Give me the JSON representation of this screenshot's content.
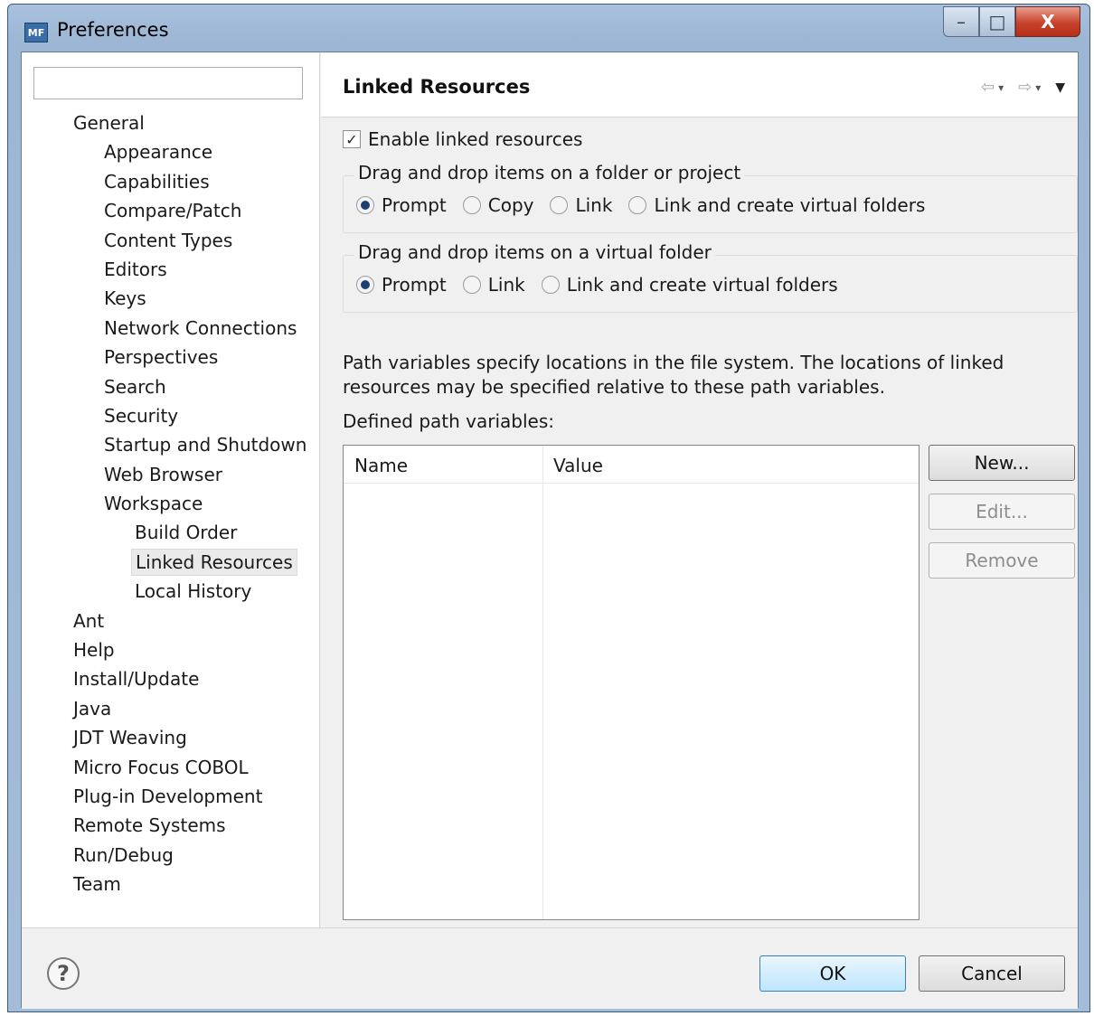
{
  "window": {
    "title": "Preferences",
    "app_icon_text": "MF",
    "minimize_glyph": "–",
    "maximize_glyph": "□",
    "close_glyph": "X"
  },
  "tree": {
    "filter_value": "",
    "items": [
      {
        "label": "General",
        "level": 0
      },
      {
        "label": "Appearance",
        "level": 1
      },
      {
        "label": "Capabilities",
        "level": 1
      },
      {
        "label": "Compare/Patch",
        "level": 1
      },
      {
        "label": "Content Types",
        "level": 1
      },
      {
        "label": "Editors",
        "level": 1
      },
      {
        "label": "Keys",
        "level": 1
      },
      {
        "label": "Network Connections",
        "level": 1
      },
      {
        "label": "Perspectives",
        "level": 1
      },
      {
        "label": "Search",
        "level": 1
      },
      {
        "label": "Security",
        "level": 1
      },
      {
        "label": "Startup and Shutdown",
        "level": 1
      },
      {
        "label": "Web Browser",
        "level": 1
      },
      {
        "label": "Workspace",
        "level": 1
      },
      {
        "label": "Build Order",
        "level": 2
      },
      {
        "label": "Linked Resources",
        "level": 2,
        "selected": true
      },
      {
        "label": "Local History",
        "level": 2
      },
      {
        "label": "Ant",
        "level": 0
      },
      {
        "label": "Help",
        "level": 0
      },
      {
        "label": "Install/Update",
        "level": 0
      },
      {
        "label": "Java",
        "level": 0
      },
      {
        "label": "JDT Weaving",
        "level": 0
      },
      {
        "label": "Micro Focus COBOL",
        "level": 0
      },
      {
        "label": "Plug-in Development",
        "level": 0
      },
      {
        "label": "Remote Systems",
        "level": 0
      },
      {
        "label": "Run/Debug",
        "level": 0
      },
      {
        "label": "Team",
        "level": 0
      }
    ]
  },
  "page": {
    "title": "Linked Resources",
    "nav": {
      "back_icon": "⇦",
      "forward_icon": "⇨",
      "caret": "▾",
      "menu_caret": "▼"
    },
    "enable_linked": {
      "label": "Enable linked resources",
      "checked": true,
      "check_glyph": "✓"
    },
    "group1": {
      "legend": "Drag and drop items on a folder or project",
      "options": [
        {
          "label": "Prompt",
          "selected": true
        },
        {
          "label": "Copy",
          "selected": false
        },
        {
          "label": "Link",
          "selected": false
        },
        {
          "label": "Link and create virtual folders",
          "selected": false
        }
      ]
    },
    "group2": {
      "legend": "Drag and drop items on a virtual folder",
      "options": [
        {
          "label": "Prompt",
          "selected": true
        },
        {
          "label": "Link",
          "selected": false
        },
        {
          "label": "Link and create virtual folders",
          "selected": false
        }
      ]
    },
    "description": "Path variables specify locations in the file system. The locations of linked resources may be specified relative to these path variables.",
    "defined_label": "Defined path variables:",
    "table": {
      "columns": [
        "Name",
        "Value"
      ],
      "rows": []
    },
    "buttons": {
      "new": "New...",
      "edit": "Edit...",
      "remove": "Remove"
    }
  },
  "footer": {
    "help_glyph": "?",
    "ok": "OK",
    "cancel": "Cancel"
  }
}
